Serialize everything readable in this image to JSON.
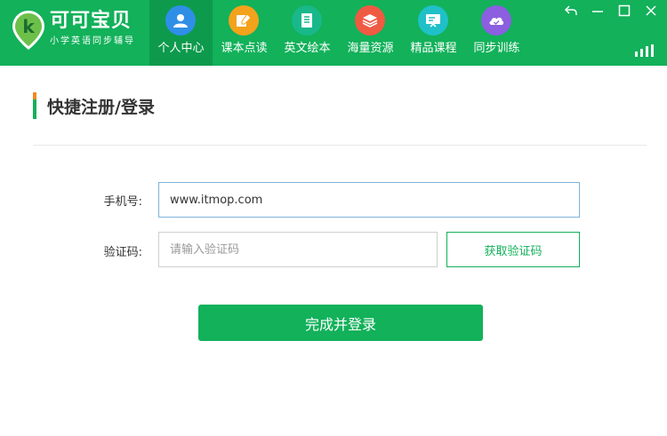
{
  "app": {
    "title": "可可宝贝",
    "subtitle": "小学英语同步辅导",
    "brand_color": "#12b15a"
  },
  "nav": {
    "items": [
      {
        "label": "个人中心",
        "icon": "person-icon",
        "color": "#2f8fe6",
        "active": true
      },
      {
        "label": "课本点读",
        "icon": "read-pen-icon",
        "color": "#f3a21c",
        "active": false
      },
      {
        "label": "英文绘本",
        "icon": "book-icon",
        "color": "#19b88a",
        "active": false
      },
      {
        "label": "海量资源",
        "icon": "layers-icon",
        "color": "#ef5a43",
        "active": false
      },
      {
        "label": "精品课程",
        "icon": "screen-icon",
        "color": "#1fc0c8",
        "active": false
      },
      {
        "label": "同步训练",
        "icon": "cloud-icon",
        "color": "#8b5fe0",
        "active": false
      }
    ]
  },
  "window": {
    "back_icon": "back-arrow-icon",
    "minimize_icon": "minimize-icon",
    "maximize_icon": "maximize-icon",
    "close_icon": "close-icon",
    "signal_icon": "signal-icon"
  },
  "section": {
    "title": "快捷注册/登录"
  },
  "form": {
    "phone_label": "手机号:",
    "phone_value": "www.itmop.com",
    "code_label": "验证码:",
    "code_placeholder": "请输入验证码",
    "get_code_label": "获取验证码",
    "submit_label": "完成并登录"
  }
}
